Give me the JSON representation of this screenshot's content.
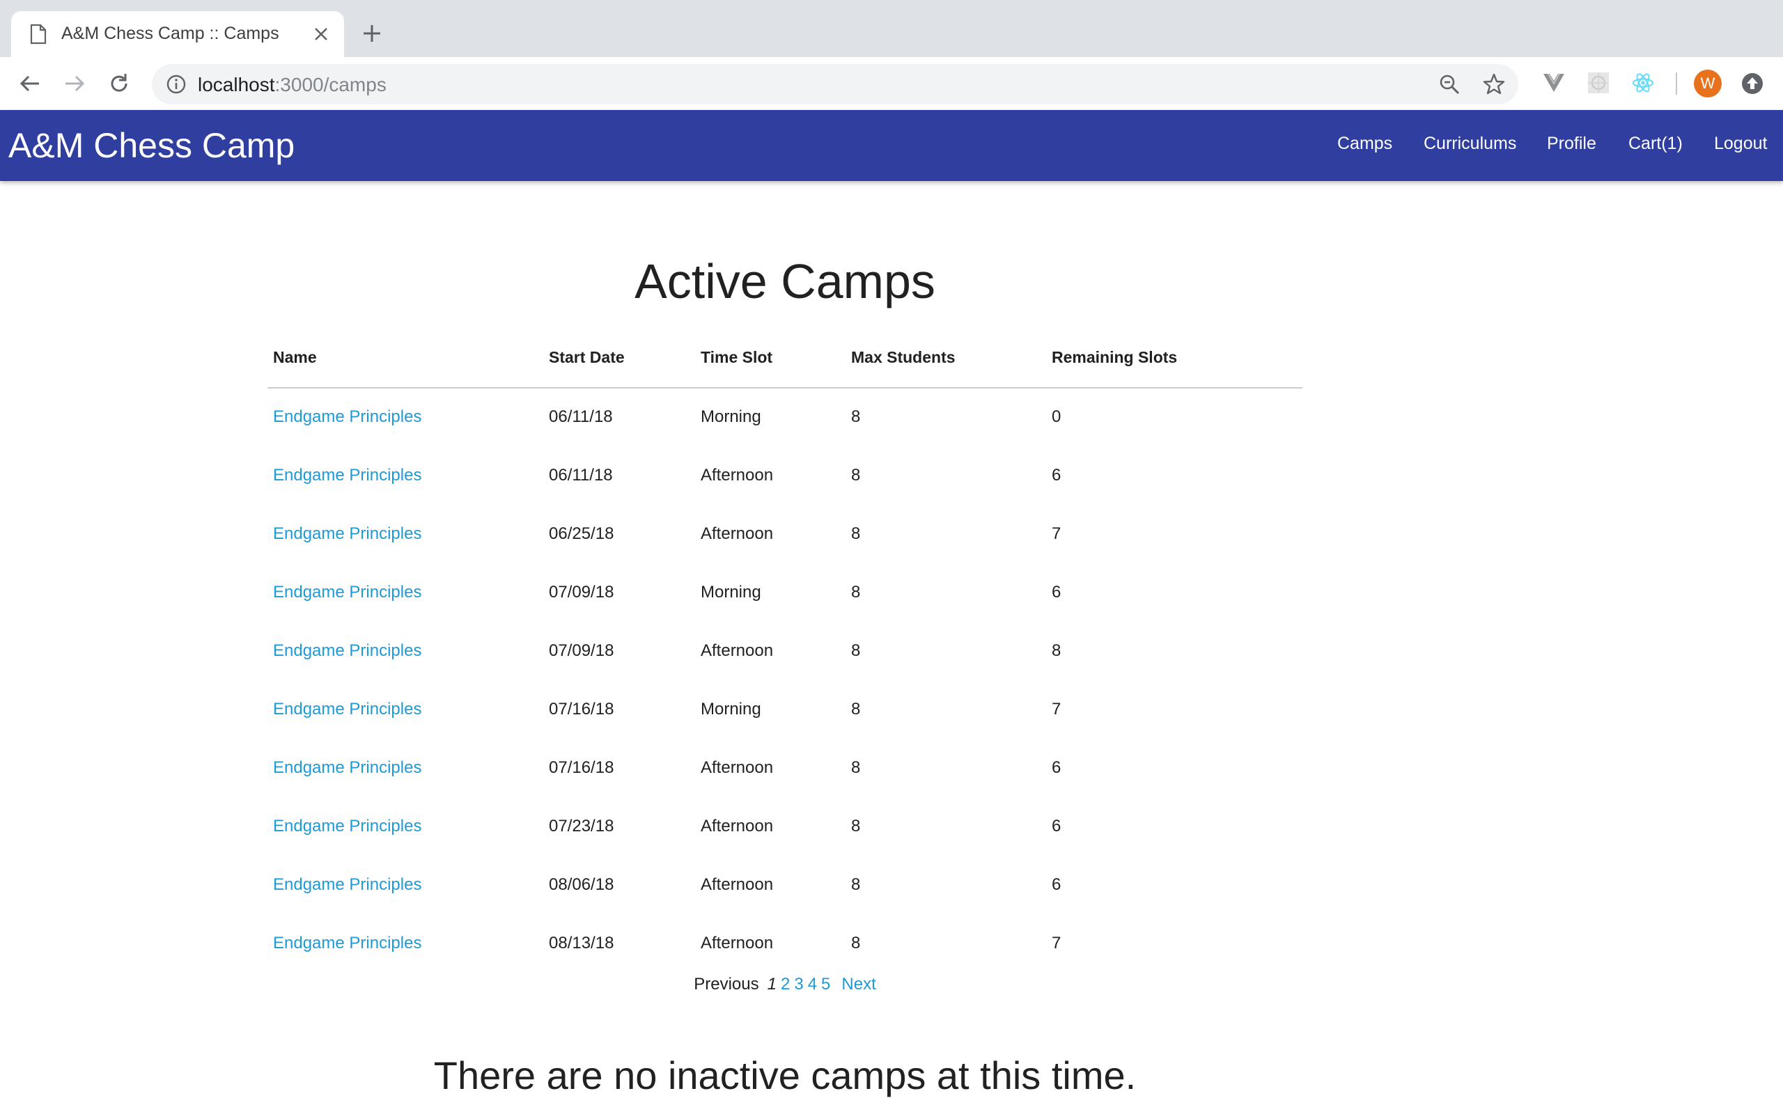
{
  "browser": {
    "tab_title": "A&M Chess Camp :: Camps",
    "url_host": "localhost",
    "url_path": ":3000/camps",
    "avatar_letter": "W"
  },
  "navbar": {
    "brand": "A&M Chess Camp",
    "items": [
      {
        "label": "Camps"
      },
      {
        "label": "Curriculums"
      },
      {
        "label": "Profile"
      },
      {
        "label": "Cart(1)"
      },
      {
        "label": "Logout"
      }
    ]
  },
  "main": {
    "title": "Active Camps",
    "columns": [
      "Name",
      "Start Date",
      "Time Slot",
      "Max Students",
      "Remaining Slots"
    ],
    "rows": [
      {
        "name": "Endgame Principles",
        "start": "06/11/18",
        "slot": "Morning",
        "max": "8",
        "remaining": "0"
      },
      {
        "name": "Endgame Principles",
        "start": "06/11/18",
        "slot": "Afternoon",
        "max": "8",
        "remaining": "6"
      },
      {
        "name": "Endgame Principles",
        "start": "06/25/18",
        "slot": "Afternoon",
        "max": "8",
        "remaining": "7"
      },
      {
        "name": "Endgame Principles",
        "start": "07/09/18",
        "slot": "Morning",
        "max": "8",
        "remaining": "6"
      },
      {
        "name": "Endgame Principles",
        "start": "07/09/18",
        "slot": "Afternoon",
        "max": "8",
        "remaining": "8"
      },
      {
        "name": "Endgame Principles",
        "start": "07/16/18",
        "slot": "Morning",
        "max": "8",
        "remaining": "7"
      },
      {
        "name": "Endgame Principles",
        "start": "07/16/18",
        "slot": "Afternoon",
        "max": "8",
        "remaining": "6"
      },
      {
        "name": "Endgame Principles",
        "start": "07/23/18",
        "slot": "Afternoon",
        "max": "8",
        "remaining": "6"
      },
      {
        "name": "Endgame Principles",
        "start": "08/06/18",
        "slot": "Afternoon",
        "max": "8",
        "remaining": "6"
      },
      {
        "name": "Endgame Principles",
        "start": "08/13/18",
        "slot": "Afternoon",
        "max": "8",
        "remaining": "7"
      }
    ],
    "pagination": {
      "previous": "Previous",
      "current": "1",
      "pages": [
        "2",
        "3",
        "4",
        "5"
      ],
      "next": "Next"
    },
    "inactive_message": "There are no inactive camps at this time."
  },
  "colors": {
    "navbar": "#303f9f",
    "link": "#1e9ad6",
    "tabstrip": "#dee1e6",
    "avatar": "#e8711c"
  }
}
